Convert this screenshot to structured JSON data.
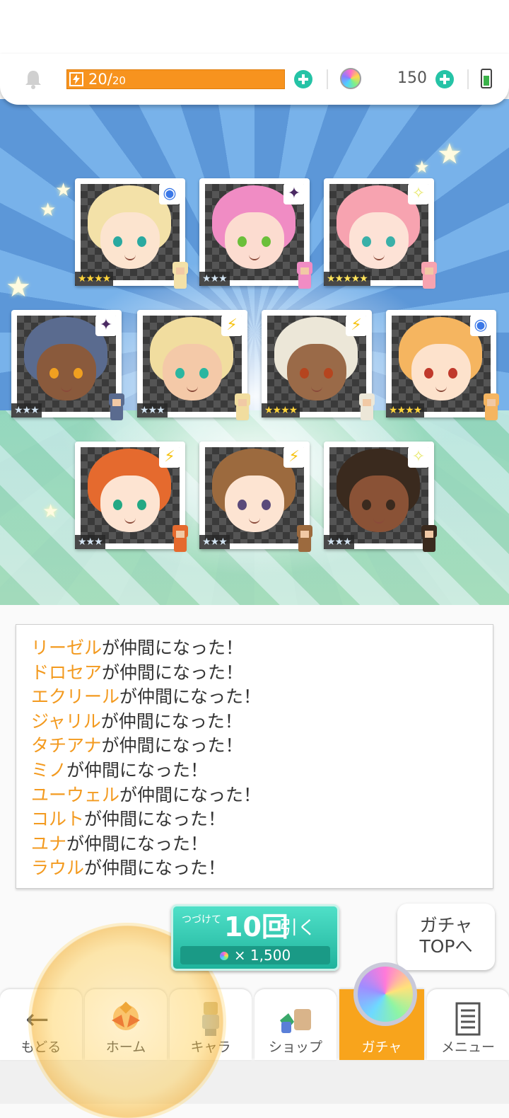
{
  "header": {
    "stamina_current": "20",
    "stamina_max": "20",
    "stamina_separator": "/",
    "gems": "150"
  },
  "results": [
    {
      "name": "リーゼル",
      "stars": "★★★★",
      "rarity": 4,
      "element": "water",
      "element_glyph": "◉",
      "hair": "#f3e1a8",
      "skin": "#fce4cf",
      "eyes": "#2aa9a0"
    },
    {
      "name": "ドロセア",
      "stars": "★★★",
      "rarity": 3,
      "element": "dark",
      "element_glyph": "✦",
      "hair": "#f08cc4",
      "skin": "#fcdcd0",
      "eyes": "#6bbf3a"
    },
    {
      "name": "エクリール",
      "stars": "★★★★★",
      "rarity": 5,
      "element": "light",
      "element_glyph": "✧",
      "hair": "#f7a3b0",
      "skin": "#fde2d6",
      "eyes": "#3ab0a8"
    },
    {
      "name": "ジャリル",
      "stars": "★★★",
      "rarity": 3,
      "element": "dark",
      "element_glyph": "✦",
      "hair": "#5a6b8f",
      "skin": "#8a5a3c",
      "eyes": "#f0a020"
    },
    {
      "name": "タチアナ",
      "stars": "★★★",
      "rarity": 3,
      "element": "thunder",
      "element_glyph": "⚡",
      "hair": "#f1dd9f",
      "skin": "#f4c9a8",
      "eyes": "#2bb6a0"
    },
    {
      "name": "ミノ",
      "stars": "★★★★",
      "rarity": 4,
      "element": "thunder",
      "element_glyph": "⚡",
      "hair": "#ece7d8",
      "skin": "#9a6a48",
      "eyes": "#b5451f"
    },
    {
      "name": "ユーウェル",
      "stars": "★★★★",
      "rarity": 4,
      "element": "water",
      "element_glyph": "◉",
      "hair": "#f5b560",
      "skin": "#fde2cc",
      "eyes": "#c0392b"
    },
    {
      "name": "コルト",
      "stars": "★★★",
      "rarity": 3,
      "element": "thunder",
      "element_glyph": "⚡",
      "hair": "#e56a2e",
      "skin": "#fde4d2",
      "eyes": "#23a884"
    },
    {
      "name": "ユナ",
      "stars": "★★★",
      "rarity": 3,
      "element": "thunder",
      "element_glyph": "⚡",
      "hair": "#9c6a3e",
      "skin": "#fde4d2",
      "eyes": "#5a4a7a"
    },
    {
      "name": "ラウル",
      "stars": "★★★",
      "rarity": 3,
      "element": "light",
      "element_glyph": "✧",
      "hair": "#3a2a1e",
      "skin": "#8a5236",
      "eyes": "#3a2a1e"
    }
  ],
  "log": {
    "suffix": "が仲間になった！"
  },
  "pull_button": {
    "prefix": "つづけて",
    "count": "10回",
    "action": "引く",
    "cost": "× 1,500"
  },
  "top_button": {
    "line1": "ガチャ",
    "line2": "TOPへ"
  },
  "nav": {
    "back": "もどる",
    "home": "ホーム",
    "chara": "キャラ",
    "shop": "ショップ",
    "gacha": "ガチャ",
    "menu": "メニュー"
  },
  "colors": {
    "accent_orange": "#f7931e",
    "accent_teal": "#25c3a6",
    "name_highlight": "#f39a1f",
    "nav_active": "#f8a41c"
  },
  "icons": {
    "bell": "bell-icon",
    "stamina": "lightning-icon",
    "gem": "rainbow-gem-icon",
    "battery": "battery-icon",
    "back": "arrow-left-icon",
    "menu": "list-icon"
  }
}
